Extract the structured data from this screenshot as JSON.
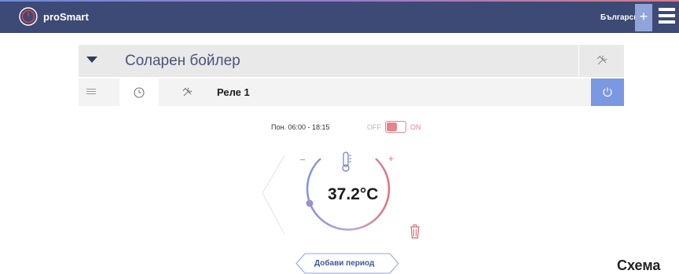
{
  "app": {
    "brand": "proSmart",
    "language": "Български",
    "plus_symbol": "+"
  },
  "device": {
    "name": "Соларен бойлер"
  },
  "relay": {
    "label": "Реле 1"
  },
  "schedule": {
    "period": "Пон. 06:00 - 18:15",
    "off_label": "OFF",
    "on_label": "ON",
    "enabled": true
  },
  "thermostat": {
    "temperature": "37.2°C",
    "minus_symbol": "−",
    "plus_symbol": "+"
  },
  "actions": {
    "add_period": "Добави период"
  },
  "caption": "Схема",
  "colors": {
    "topbar": "#3d4a75",
    "accent_blue": "#7b98e2",
    "accent_red": "#e8838a",
    "text_dark": "#1c1c1c"
  },
  "icons": {
    "logo": "power-ring-icon",
    "menu": "hamburger-icon",
    "collapse": "caret-down-icon",
    "tools": "tools-icon",
    "list": "list-icon",
    "clock": "clock-icon",
    "power": "power-icon",
    "thermometer": "thermometer-icon",
    "delete": "trash-icon"
  }
}
